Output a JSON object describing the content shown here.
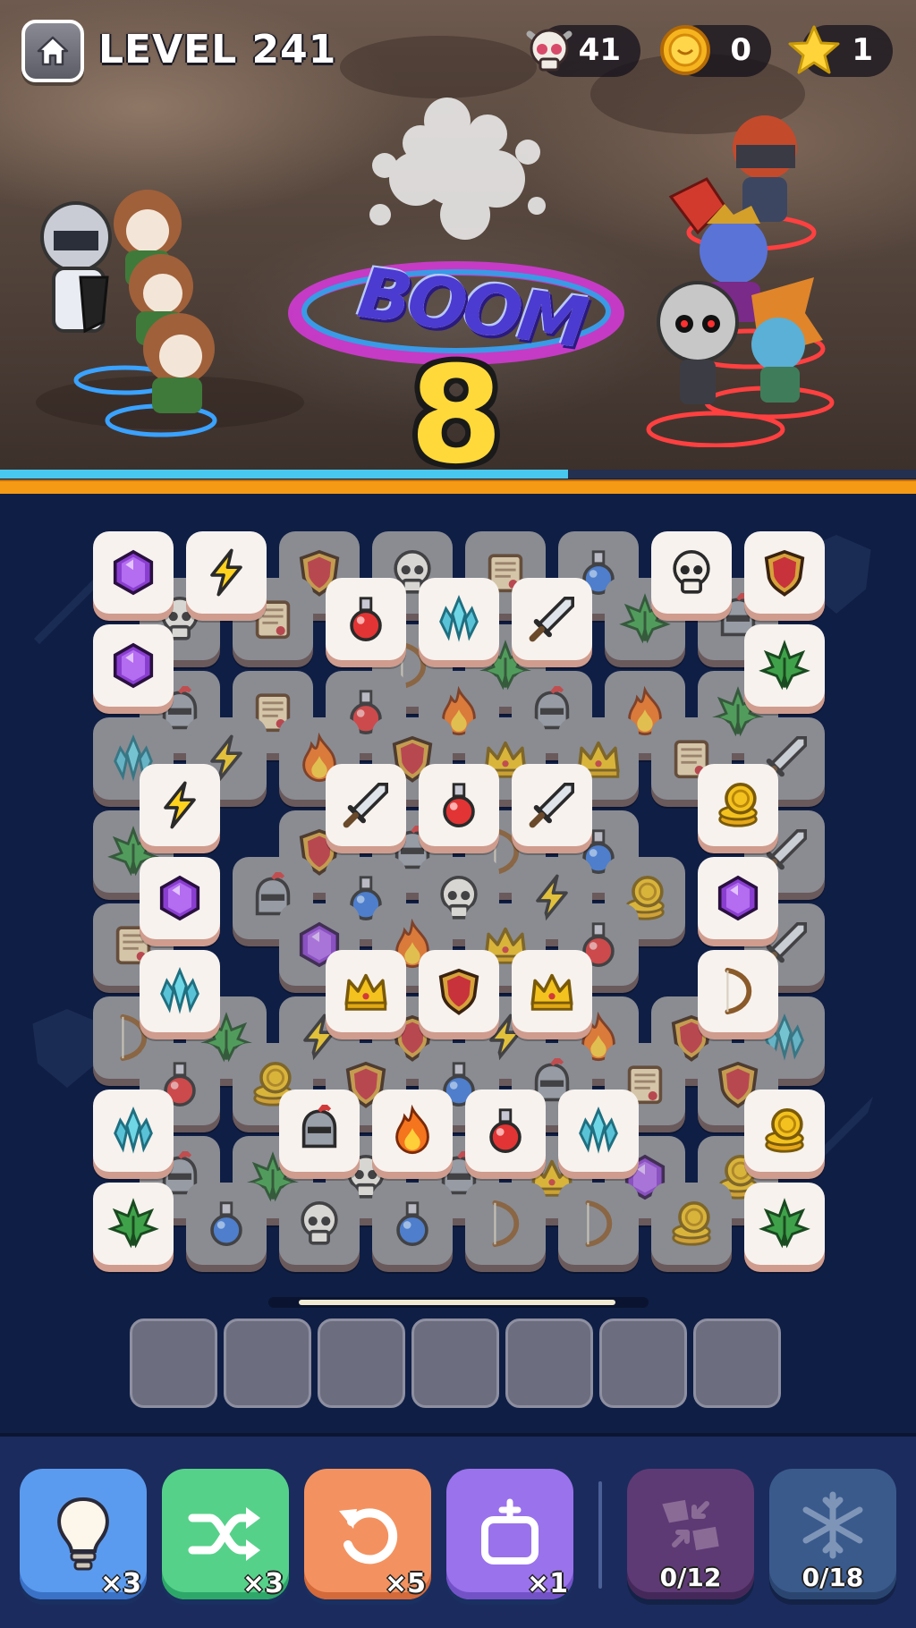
{
  "header": {
    "level_label": "LEVEL 241",
    "counters": [
      {
        "name": "skulls",
        "icon": "skull-icon",
        "value": "41"
      },
      {
        "name": "coins",
        "icon": "coin-icon",
        "value": "0"
      },
      {
        "name": "stars",
        "icon": "star-icon",
        "value": "1"
      }
    ]
  },
  "battle": {
    "effect_text": "BOOM",
    "combo_count": "8",
    "player_hp_fraction": 0.62,
    "allies": [
      "knight",
      "raccoon",
      "raccoon",
      "raccoon"
    ],
    "enemies": [
      "masked-ninja",
      "red-dragon",
      "blue-demon",
      "skeleton",
      "green-goblin"
    ]
  },
  "board": {
    "tiles": [
      {
        "c": 2.0,
        "r": 0,
        "i": "shield",
        "d": true
      },
      {
        "c": 3.0,
        "r": 0,
        "i": "skull",
        "d": true
      },
      {
        "c": 4.0,
        "r": 0,
        "i": "scroll",
        "d": true
      },
      {
        "c": 5.0,
        "r": 0,
        "i": "potion-blue",
        "d": true
      },
      {
        "c": 0.5,
        "r": 0.5,
        "i": "skull",
        "d": true
      },
      {
        "c": 1.5,
        "r": 0.5,
        "i": "scroll",
        "d": true
      },
      {
        "c": 5.5,
        "r": 0.5,
        "i": "leaf",
        "d": true
      },
      {
        "c": 6.5,
        "r": 0.5,
        "i": "helmet",
        "d": true
      },
      {
        "c": 3.0,
        "r": 1,
        "i": "bow",
        "d": true
      },
      {
        "c": 4.0,
        "r": 1,
        "i": "leaf",
        "d": true
      },
      {
        "c": 0.5,
        "r": 1.5,
        "i": "helmet",
        "d": true
      },
      {
        "c": 1.5,
        "r": 1.5,
        "i": "scroll",
        "d": true
      },
      {
        "c": 2.5,
        "r": 1.5,
        "i": "potion-red",
        "d": true
      },
      {
        "c": 3.5,
        "r": 1.5,
        "i": "fire",
        "d": true
      },
      {
        "c": 4.5,
        "r": 1.5,
        "i": "helmet",
        "d": true
      },
      {
        "c": 5.5,
        "r": 1.5,
        "i": "fire",
        "d": true
      },
      {
        "c": 6.5,
        "r": 1.5,
        "i": "leaf",
        "d": true
      },
      {
        "c": 0,
        "r": 2,
        "i": "crystal",
        "d": true
      },
      {
        "c": 1,
        "r": 2,
        "i": "lightning",
        "d": true
      },
      {
        "c": 2,
        "r": 2,
        "i": "fire",
        "d": true
      },
      {
        "c": 3,
        "r": 2,
        "i": "shield",
        "d": true
      },
      {
        "c": 4,
        "r": 2,
        "i": "crown",
        "d": true
      },
      {
        "c": 5,
        "r": 2,
        "i": "crown",
        "d": true
      },
      {
        "c": 6,
        "r": 2,
        "i": "scroll",
        "d": true
      },
      {
        "c": 7,
        "r": 2,
        "i": "sword",
        "d": true
      },
      {
        "c": 0,
        "r": 3,
        "i": "leaf",
        "d": true
      },
      {
        "c": 2,
        "r": 3,
        "i": "shield",
        "d": true
      },
      {
        "c": 3,
        "r": 3,
        "i": "helmet",
        "d": true
      },
      {
        "c": 4,
        "r": 3,
        "i": "bow",
        "d": true
      },
      {
        "c": 5,
        "r": 3,
        "i": "potion-blue",
        "d": true
      },
      {
        "c": 7,
        "r": 3,
        "i": "sword",
        "d": true
      },
      {
        "c": 1.5,
        "r": 3.5,
        "i": "helmet",
        "d": true
      },
      {
        "c": 2.5,
        "r": 3.5,
        "i": "potion-blue",
        "d": true
      },
      {
        "c": 3.5,
        "r": 3.5,
        "i": "skull",
        "d": true
      },
      {
        "c": 4.5,
        "r": 3.5,
        "i": "lightning",
        "d": true
      },
      {
        "c": 5.5,
        "r": 3.5,
        "i": "coins",
        "d": true
      },
      {
        "c": 0,
        "r": 4,
        "i": "scroll",
        "d": true
      },
      {
        "c": 2,
        "r": 4,
        "i": "gem",
        "d": true
      },
      {
        "c": 3,
        "r": 4,
        "i": "fire",
        "d": true
      },
      {
        "c": 4,
        "r": 4,
        "i": "crown",
        "d": true
      },
      {
        "c": 5,
        "r": 4,
        "i": "potion-red",
        "d": true
      },
      {
        "c": 7,
        "r": 4,
        "i": "sword",
        "d": true
      },
      {
        "c": 0,
        "r": 5,
        "i": "bow",
        "d": true
      },
      {
        "c": 1,
        "r": 5,
        "i": "leaf",
        "d": true
      },
      {
        "c": 2,
        "r": 5,
        "i": "lightning",
        "d": true
      },
      {
        "c": 3,
        "r": 5,
        "i": "shield",
        "d": true
      },
      {
        "c": 4,
        "r": 5,
        "i": "lightning",
        "d": true
      },
      {
        "c": 5,
        "r": 5,
        "i": "fire",
        "d": true
      },
      {
        "c": 6,
        "r": 5,
        "i": "shield",
        "d": true
      },
      {
        "c": 7,
        "r": 5,
        "i": "crystal",
        "d": true
      },
      {
        "c": 0.5,
        "r": 5.5,
        "i": "potion-red",
        "d": true
      },
      {
        "c": 1.5,
        "r": 5.5,
        "i": "coins",
        "d": true
      },
      {
        "c": 2.5,
        "r": 5.5,
        "i": "shield",
        "d": true
      },
      {
        "c": 3.5,
        "r": 5.5,
        "i": "potion-blue",
        "d": true
      },
      {
        "c": 4.5,
        "r": 5.5,
        "i": "helmet",
        "d": true
      },
      {
        "c": 5.5,
        "r": 5.5,
        "i": "scroll",
        "d": true
      },
      {
        "c": 6.5,
        "r": 5.5,
        "i": "shield",
        "d": true
      },
      {
        "c": 0.5,
        "r": 6.5,
        "i": "helmet",
        "d": true
      },
      {
        "c": 1.5,
        "r": 6.5,
        "i": "leaf",
        "d": true
      },
      {
        "c": 2.5,
        "r": 6.5,
        "i": "skull",
        "d": true
      },
      {
        "c": 3.5,
        "r": 6.5,
        "i": "helmet",
        "d": true
      },
      {
        "c": 4.5,
        "r": 6.5,
        "i": "crown",
        "d": true
      },
      {
        "c": 5.5,
        "r": 6.5,
        "i": "gem",
        "d": true
      },
      {
        "c": 6.5,
        "r": 6.5,
        "i": "coins",
        "d": true
      },
      {
        "c": 1,
        "r": 7,
        "i": "potion-blue",
        "d": true
      },
      {
        "c": 2,
        "r": 7,
        "i": "skull",
        "d": true
      },
      {
        "c": 3,
        "r": 7,
        "i": "potion-blue",
        "d": true
      },
      {
        "c": 4,
        "r": 7,
        "i": "bow",
        "d": true
      },
      {
        "c": 5,
        "r": 7,
        "i": "bow",
        "d": true
      },
      {
        "c": 6,
        "r": 7,
        "i": "coins",
        "d": true
      },
      {
        "c": 0,
        "r": 0,
        "i": "gem",
        "d": false
      },
      {
        "c": 1,
        "r": 0,
        "i": "lightning",
        "d": false
      },
      {
        "c": 6,
        "r": 0,
        "i": "skull",
        "d": false
      },
      {
        "c": 7,
        "r": 0,
        "i": "shield",
        "d": false
      },
      {
        "c": 2.5,
        "r": 0.5,
        "i": "potion-red",
        "d": false
      },
      {
        "c": 3.5,
        "r": 0.5,
        "i": "crystal",
        "d": false
      },
      {
        "c": 4.5,
        "r": 0.5,
        "i": "sword",
        "d": false
      },
      {
        "c": 0,
        "r": 1,
        "i": "gem",
        "d": false
      },
      {
        "c": 7,
        "r": 1,
        "i": "leaf",
        "d": false
      },
      {
        "c": 0.5,
        "r": 2.5,
        "i": "lightning",
        "d": false
      },
      {
        "c": 2.5,
        "r": 2.5,
        "i": "sword",
        "d": false
      },
      {
        "c": 3.5,
        "r": 2.5,
        "i": "potion-red",
        "d": false
      },
      {
        "c": 4.5,
        "r": 2.5,
        "i": "sword",
        "d": false
      },
      {
        "c": 6.5,
        "r": 2.5,
        "i": "coins",
        "d": false
      },
      {
        "c": 0.5,
        "r": 3.5,
        "i": "gem",
        "d": false
      },
      {
        "c": 6.5,
        "r": 3.5,
        "i": "gem",
        "d": false
      },
      {
        "c": 0.5,
        "r": 4.5,
        "i": "crystal",
        "d": false
      },
      {
        "c": 2.5,
        "r": 4.5,
        "i": "crown",
        "d": false
      },
      {
        "c": 3.5,
        "r": 4.5,
        "i": "shield",
        "d": false
      },
      {
        "c": 4.5,
        "r": 4.5,
        "i": "crown",
        "d": false
      },
      {
        "c": 6.5,
        "r": 4.5,
        "i": "bow",
        "d": false
      },
      {
        "c": 0,
        "r": 6,
        "i": "crystal",
        "d": false
      },
      {
        "c": 2,
        "r": 6,
        "i": "helmet",
        "d": false
      },
      {
        "c": 3,
        "r": 6,
        "i": "fire",
        "d": false
      },
      {
        "c": 4,
        "r": 6,
        "i": "potion-red",
        "d": false
      },
      {
        "c": 5,
        "r": 6,
        "i": "crystal",
        "d": false
      },
      {
        "c": 7,
        "r": 6,
        "i": "coins",
        "d": false
      },
      {
        "c": 0,
        "r": 7,
        "i": "leaf",
        "d": false
      },
      {
        "c": 7,
        "r": 7,
        "i": "leaf",
        "d": false
      }
    ]
  },
  "tray": {
    "slot_count": 7,
    "filled": 0
  },
  "powerups": [
    {
      "name": "hint",
      "icon": "lightbulb-icon",
      "count": "×3",
      "color": "#5b9bef"
    },
    {
      "name": "shuffle",
      "icon": "shuffle-icon",
      "count": "×3",
      "color": "#56d18a"
    },
    {
      "name": "undo",
      "icon": "undo-icon",
      "count": "×5",
      "color": "#f39260"
    },
    {
      "name": "add-slot",
      "icon": "add-slot-icon",
      "count": "×1",
      "color": "#9a72ec"
    }
  ],
  "boosters": [
    {
      "name": "merge",
      "icon": "merge-icon",
      "progress": "0/12",
      "color": "#5e3a74"
    },
    {
      "name": "freeze",
      "icon": "snowflake-icon",
      "progress": "0/18",
      "color": "#3a5a8c"
    }
  ]
}
